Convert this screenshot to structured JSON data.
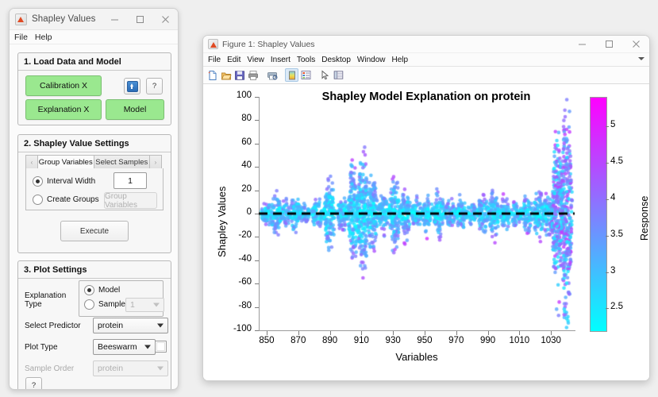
{
  "app": {
    "title": "Shapley Values",
    "window_buttons": [
      "minimize",
      "maximize",
      "close"
    ],
    "menu": [
      "File",
      "Help"
    ],
    "panel1": {
      "title": "1. Load Data and Model",
      "calibration_btn": "Calibration X",
      "explanation_btn": "Explanation X",
      "model_btn": "Model",
      "help_btn": "?",
      "load_icon": "upload-icon"
    },
    "panel2": {
      "title": "2. Shapley Value Settings",
      "tab_prev": "‹",
      "tab_next": "›",
      "tabs": [
        "Group Variables",
        "Select Samples"
      ],
      "active_tab": "Group Variables",
      "interval_width_label": "Interval Width",
      "interval_width_value": "1",
      "create_groups_label": "Create Groups",
      "group_variables_btn": "Group Variables",
      "execute_btn": "Execute"
    },
    "panel3": {
      "title": "3. Plot Settings",
      "explanation_type_label": "Explanation Type",
      "model_radio": "Model",
      "sample_radio": "Sample",
      "sample_value": "1",
      "select_predictor_label": "Select Predictor",
      "select_predictor_value": "protein",
      "plot_type_label": "Plot Type",
      "plot_type_value": "Beeswarm",
      "sample_order_label": "Sample Order",
      "sample_order_value": "protein",
      "help_btn": "?"
    }
  },
  "figure": {
    "title": "Figure 1: Shapley Values",
    "window_buttons": [
      "minimize",
      "maximize",
      "close"
    ],
    "menu": [
      "File",
      "Edit",
      "View",
      "Insert",
      "Tools",
      "Desktop",
      "Window",
      "Help"
    ],
    "toolbar_icons": [
      "new-figure-icon",
      "open-file-icon",
      "save-figure-icon",
      "print-figure-icon",
      "print-preview-icon",
      "colorbar-icon",
      "legend-icon",
      "pointer-icon",
      "property-inspector-icon"
    ],
    "toolbar_selected": "colorbar-icon"
  },
  "chart_data": {
    "type": "scatter",
    "title": "Shapley Model Explanation on protein",
    "xlabel": "Variables",
    "ylabel": "Shapley Values",
    "xlim": [
      845,
      1045
    ],
    "ylim": [
      -100,
      100
    ],
    "xticks": [
      850,
      870,
      890,
      910,
      930,
      950,
      970,
      990,
      1010,
      1030
    ],
    "yticks": [
      -100,
      -80,
      -60,
      -40,
      -20,
      0,
      20,
      40,
      60,
      80,
      100
    ],
    "grid": false,
    "reference_line": {
      "y": 0,
      "style": "dashed",
      "color": "#000000"
    },
    "colorbar": {
      "label": "Response",
      "ticks": [
        2.5,
        3,
        3.5,
        4,
        4.5,
        5
      ],
      "range": [
        2.2,
        5.4
      ],
      "colormap": "cool",
      "low_color": "#00ffff",
      "high_color": "#ff00ff",
      "position": "right"
    },
    "plot_kind": "beeswarm",
    "description": "Beeswarm of Shapley values per spectral variable (wavelength); point color encodes Response value from 2.2 (cyan) to 5.4 (magenta).",
    "clusters": [
      {
        "x": 850,
        "spread": 10,
        "n": 60
      },
      {
        "x": 856,
        "spread": 16,
        "n": 90
      },
      {
        "x": 862,
        "spread": 9,
        "n": 60
      },
      {
        "x": 868,
        "spread": 14,
        "n": 80
      },
      {
        "x": 874,
        "spread": 8,
        "n": 55
      },
      {
        "x": 882,
        "spread": 12,
        "n": 70
      },
      {
        "x": 890,
        "spread": 30,
        "n": 150
      },
      {
        "x": 898,
        "spread": 14,
        "n": 80
      },
      {
        "x": 905,
        "spread": 38,
        "n": 180
      },
      {
        "x": 911,
        "spread": 44,
        "n": 200
      },
      {
        "x": 917,
        "spread": 30,
        "n": 150
      },
      {
        "x": 924,
        "spread": 16,
        "n": 85
      },
      {
        "x": 931,
        "spread": 28,
        "n": 140
      },
      {
        "x": 938,
        "spread": 20,
        "n": 100
      },
      {
        "x": 945,
        "spread": 11,
        "n": 65
      },
      {
        "x": 952,
        "spread": 15,
        "n": 80
      },
      {
        "x": 959,
        "spread": 18,
        "n": 95
      },
      {
        "x": 966,
        "spread": 11,
        "n": 65
      },
      {
        "x": 973,
        "spread": 13,
        "n": 75
      },
      {
        "x": 980,
        "spread": 10,
        "n": 60
      },
      {
        "x": 987,
        "spread": 16,
        "n": 85
      },
      {
        "x": 994,
        "spread": 19,
        "n": 100
      },
      {
        "x": 1001,
        "spread": 13,
        "n": 75
      },
      {
        "x": 1008,
        "spread": 10,
        "n": 60
      },
      {
        "x": 1015,
        "spread": 14,
        "n": 80
      },
      {
        "x": 1022,
        "spread": 20,
        "n": 100
      },
      {
        "x": 1028,
        "spread": 16,
        "n": 85
      },
      {
        "x": 1034,
        "spread": 62,
        "n": 260
      },
      {
        "x": 1040,
        "spread": 88,
        "n": 300
      }
    ]
  }
}
